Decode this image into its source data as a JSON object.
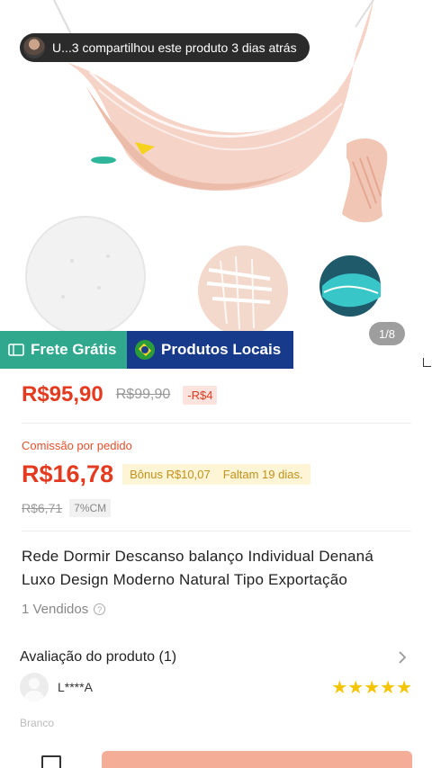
{
  "share": {
    "text": "U...3 compartilhou este produto 3 dias atrás"
  },
  "gallery": {
    "counter": "1/8"
  },
  "badges": {
    "frete": "Frete Grátis",
    "locais": "Produtos Locais"
  },
  "price": {
    "current": "R$95,90",
    "original": "R$99,90",
    "discount": "-R$4"
  },
  "commission": {
    "label": "Comissão por pedido",
    "value": "R$16,78",
    "bonus": "Bônus R$10,07",
    "remaining": "Faltam 19 dias.",
    "old_value": "R$6,71",
    "percent": "7%CM"
  },
  "product": {
    "title": "Rede Dormir Descanso balanço Individual Denaná Luxo Design Moderno Natural Tipo Exportação",
    "sold": "1 Vendidos"
  },
  "reviews": {
    "title": "Avaliação do produto (1)",
    "reviewer": "L****A",
    "stars": "★★★★★",
    "variant": "Branco"
  },
  "colors": {
    "price_red": "#e43a1f",
    "frete_green": "#2fa88d",
    "locais_blue": "#173a8a",
    "star_yellow": "#f5c400",
    "buy_button": "#f4ad96"
  }
}
